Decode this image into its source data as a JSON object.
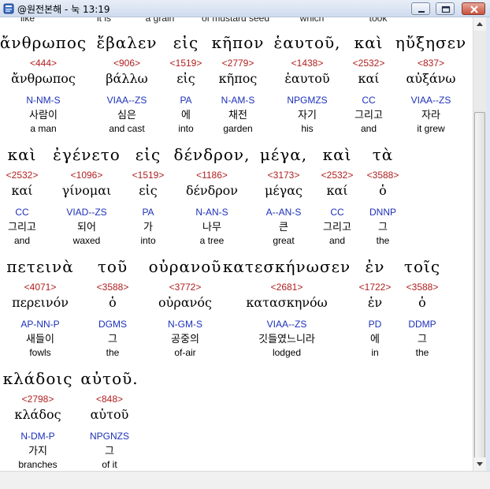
{
  "window": {
    "title": "@원전본해 - 눅 13:19",
    "controls": {
      "minimize": "minimize",
      "maximize": "maximize",
      "close": "close"
    }
  },
  "cut_row": [
    "like",
    "it is",
    "a grain",
    "of mustard seed",
    "which",
    "took"
  ],
  "rows": [
    {
      "words": [
        {
          "greek": "ἄνθρωπος",
          "strong": "<444>",
          "lemma": "ἄνθρωπος",
          "morph": "N-NM-S",
          "korean": "사람이",
          "english": "a man"
        },
        {
          "greek": "ἔβαλεν",
          "strong": "<906>",
          "lemma": "βάλλω",
          "morph": "VIAA--ZS",
          "korean": "심은",
          "english": "and cast"
        },
        {
          "greek": "εἰς",
          "strong": "<1519>",
          "lemma": "εἰς",
          "morph": "PA",
          "korean": "에",
          "english": "into"
        },
        {
          "greek": "κῆπον",
          "strong": "<2779>",
          "lemma": "κῆπος",
          "morph": "N-AM-S",
          "korean": "채전",
          "english": "garden"
        },
        {
          "greek": "ἑαυτοῦ,",
          "strong": "<1438>",
          "lemma": "ἑαυτοῦ",
          "morph": "NPGMZS",
          "korean": "자기",
          "english": "his"
        },
        {
          "greek": "καὶ",
          "strong": "<2532>",
          "lemma": "καί",
          "morph": "CC",
          "korean": "그리고",
          "english": "and"
        },
        {
          "greek": "ηὔξησεν",
          "strong": "<837>",
          "lemma": "αὐξάνω",
          "morph": "VIAA--ZS",
          "korean": "자라",
          "english": "it grew"
        }
      ]
    },
    {
      "words": [
        {
          "greek": "καὶ",
          "strong": "<2532>",
          "lemma": "καί",
          "morph": "CC",
          "korean": "그리고",
          "english": "and"
        },
        {
          "greek": "ἐγένετο",
          "strong": "<1096>",
          "lemma": "γίνομαι",
          "morph": "VIAD--ZS",
          "korean": "되어",
          "english": "waxed"
        },
        {
          "greek": "εἰς",
          "strong": "<1519>",
          "lemma": "εἰς",
          "morph": "PA",
          "korean": "가",
          "english": "into"
        },
        {
          "greek": "δένδρον,",
          "strong": "<1186>",
          "lemma": "δένδρον",
          "morph": "N-AN-S",
          "korean": "나무",
          "english": "a tree"
        },
        {
          "greek": "μέγα,",
          "strong": "<3173>",
          "lemma": "μέγας",
          "morph": "A--AN-S",
          "korean": "큰",
          "english": "great"
        },
        {
          "greek": "καὶ",
          "strong": "<2532>",
          "lemma": "καί",
          "morph": "CC",
          "korean": "그리고",
          "english": "and"
        },
        {
          "greek": "τὰ",
          "strong": "<3588>",
          "lemma": "ὁ",
          "morph": "DNNP",
          "korean": "그",
          "english": "the"
        }
      ]
    },
    {
      "words": [
        {
          "greek": "πετεινὰ",
          "strong": "<4071>",
          "lemma": "περεινόν",
          "morph": "AP-NN-P",
          "korean": "새들이",
          "english": "fowls"
        },
        {
          "greek": "τοῦ",
          "strong": "<3588>",
          "lemma": "ὁ",
          "morph": "DGMS",
          "korean": "그",
          "english": "the"
        },
        {
          "greek": "οὐρανοῦ",
          "strong": "<3772>",
          "lemma": "οὐρανός",
          "morph": "N-GM-S",
          "korean": "공중의",
          "english": "of-air"
        },
        {
          "greek": "κατεσκήνωσεν",
          "strong": "<2681>",
          "lemma": "κατασκηνόω",
          "morph": "VIAA--ZS",
          "korean": "깃들였느니라",
          "english": "lodged"
        },
        {
          "greek": "ἐν",
          "strong": "<1722>",
          "lemma": "ἐν",
          "morph": "PD",
          "korean": "에",
          "english": "in"
        },
        {
          "greek": "τοῖς",
          "strong": "<3588>",
          "lemma": "ὁ",
          "morph": "DDMP",
          "korean": "그",
          "english": "the"
        }
      ]
    },
    {
      "words": [
        {
          "greek": "κλάδοις",
          "strong": "<2798>",
          "lemma": "κλάδος",
          "morph": "N-DM-P",
          "korean": "가지",
          "english": "branches"
        },
        {
          "greek": "αὐτοῦ.",
          "strong": "<848>",
          "lemma": "αὑτοῦ",
          "morph": "NPGNZS",
          "korean": "그",
          "english": "of it"
        }
      ]
    }
  ]
}
